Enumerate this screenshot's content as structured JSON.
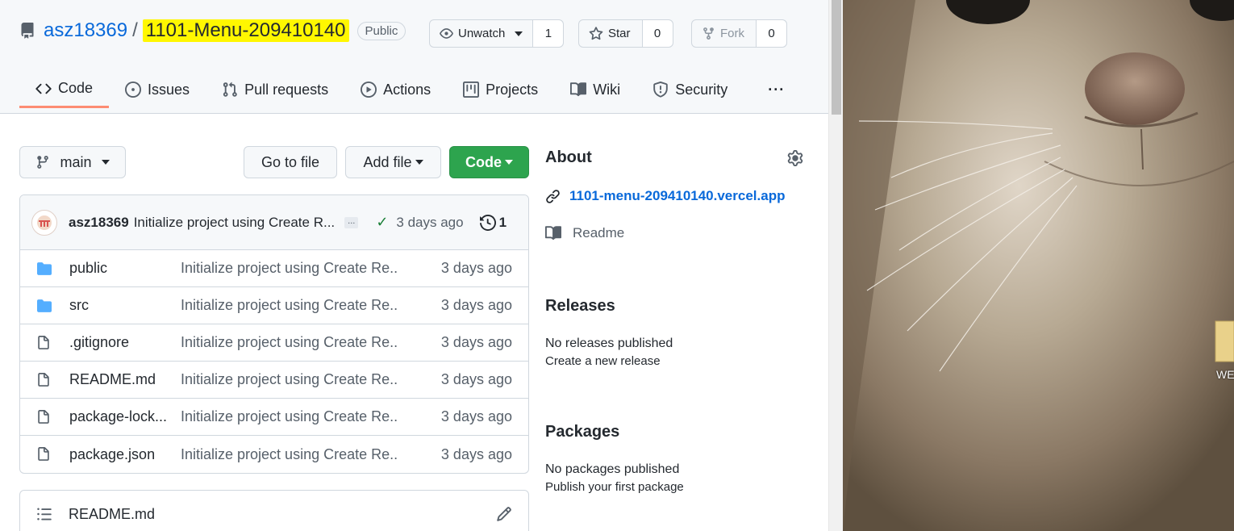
{
  "repo": {
    "owner": "asz18369",
    "separator": "/",
    "name": "1101-Menu-209410140",
    "visibility": "Public"
  },
  "actions": {
    "watch": {
      "label": "Unwatch",
      "count": "1"
    },
    "star": {
      "label": "Star",
      "count": "0"
    },
    "fork": {
      "label": "Fork",
      "count": "0"
    }
  },
  "tabs": [
    {
      "label": "Code",
      "icon": "code-icon"
    },
    {
      "label": "Issues",
      "icon": "issue-icon"
    },
    {
      "label": "Pull requests",
      "icon": "pull-request-icon"
    },
    {
      "label": "Actions",
      "icon": "play-icon"
    },
    {
      "label": "Projects",
      "icon": "project-icon"
    },
    {
      "label": "Wiki",
      "icon": "book-icon"
    },
    {
      "label": "Security",
      "icon": "shield-icon"
    },
    {
      "label": "···",
      "icon": "more-icon"
    }
  ],
  "toolbar": {
    "branch": "main",
    "go_to_file": "Go to file",
    "add_file": "Add file",
    "code": "Code"
  },
  "latest_commit": {
    "author": "asz18369",
    "message": "Initialize project using Create R...",
    "more": "...",
    "time": "3 days ago",
    "commits": "1"
  },
  "files": [
    {
      "type": "dir",
      "name": "public",
      "message": "Initialize project using Create Re...",
      "age": "3 days ago"
    },
    {
      "type": "dir",
      "name": "src",
      "message": "Initialize project using Create Re...",
      "age": "3 days ago"
    },
    {
      "type": "file",
      "name": ".gitignore",
      "message": "Initialize project using Create Re...",
      "age": "3 days ago"
    },
    {
      "type": "file",
      "name": "README.md",
      "message": "Initialize project using Create Re...",
      "age": "3 days ago"
    },
    {
      "type": "file",
      "name": "package-lock...",
      "message": "Initialize project using Create Re...",
      "age": "3 days ago"
    },
    {
      "type": "file",
      "name": "package.json",
      "message": "Initialize project using Create Re...",
      "age": "3 days ago"
    }
  ],
  "readme": {
    "title": "README.md"
  },
  "about": {
    "title": "About",
    "website": "1101-menu-209410140.vercel.app",
    "readme": "Readme"
  },
  "releases": {
    "title": "Releases",
    "none": "No releases published",
    "create": "Create a new release"
  },
  "packages": {
    "title": "Packages",
    "none": "No packages published",
    "publish": "Publish your first package"
  },
  "desktop": {
    "icon_label": "WE"
  },
  "colors": {
    "link": "#0969da",
    "highlight": "#fff700",
    "green": "#2da44e",
    "active_tab": "#fd8c73"
  }
}
